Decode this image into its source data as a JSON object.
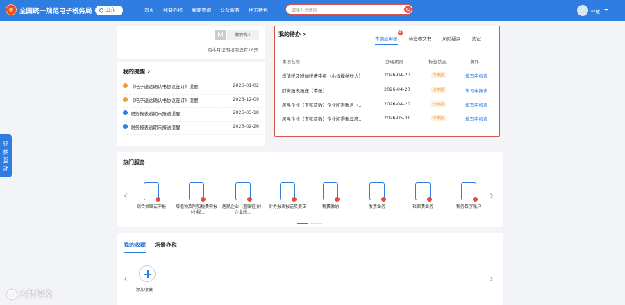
{
  "header": {
    "title": "全国统一规范电子税务局",
    "province": "山东",
    "nav": [
      "首页",
      "我要办税",
      "我要查询",
      "公众服务",
      "地方特色"
    ],
    "search_placeholder": "请输入关键词",
    "username": "**敏"
  },
  "side_float": [
    "征",
    "纳",
    "互",
    "动"
  ],
  "taxpayer": {
    "icon_letter": "M",
    "button": "缴纳税人",
    "deadline_prefix": "距本月征期结束还有",
    "deadline_days": "18",
    "deadline_suffix": "天"
  },
  "reminders": {
    "title": "我的提醒",
    "items": [
      {
        "text": "《电子送达确认书协议签订》提醒",
        "date": "2026-01-02",
        "icon": "orange"
      },
      {
        "text": "《电子送达确认书协议签订》提醒",
        "date": "2025-12-09",
        "icon": "orange"
      },
      {
        "text": "财务报表逾期未报送提醒",
        "date": "2026-03-18",
        "icon": "blue"
      },
      {
        "text": "财务报表逾期未报送提醒",
        "date": "2026-02-26",
        "icon": "blue"
      }
    ]
  },
  "todo": {
    "title": "我的待办",
    "tabs": [
      "本期应申报",
      "待签收文书",
      "风险疑点",
      "其它"
    ],
    "badge": "4",
    "columns": [
      "事项名称",
      "办理期限",
      "标签状态",
      "操作"
    ],
    "rows": [
      {
        "name": "增值税及附加税费申报（小规模纳税人）",
        "deadline": "2026-04-20",
        "status": "未申报",
        "action": "填写申报表"
      },
      {
        "name": "财务报表报送（季报）",
        "deadline": "2026-04-20",
        "status": "未申报",
        "action": "填写申报表"
      },
      {
        "name": "居民企业（查账征收）企业所得税月（...",
        "deadline": "2026-04-20",
        "status": "未申报",
        "action": "填写申报表"
      },
      {
        "name": "居民企业（查账征收）企业所得税年度...",
        "deadline": "2026-05-31",
        "status": "未申报",
        "action": "填写申报表"
      }
    ]
  },
  "hot_services": {
    "title": "热门服务",
    "items": [
      {
        "label": "综合关联式申报",
        "icon": "integrated-filing-icon"
      },
      {
        "label": "增值税及附加税费申报（小规...",
        "icon": "vat-filing-icon"
      },
      {
        "label": "居民企业（查账征收）企业所...",
        "icon": "enterprise-tax-icon"
      },
      {
        "label": "财务报表报送及更正",
        "icon": "financial-report-icon"
      },
      {
        "label": "税费缴纳",
        "icon": "tax-payment-icon"
      },
      {
        "label": "发票业务",
        "icon": "invoice-icon"
      },
      {
        "label": "社保费业务",
        "icon": "social-security-icon"
      },
      {
        "label": "税务数字账户",
        "icon": "digital-account-icon"
      }
    ]
  },
  "favorites": {
    "tabs": [
      "我的收藏",
      "场景办税"
    ],
    "add_label": "添加收藏"
  },
  "watermark": "大数跨境"
}
